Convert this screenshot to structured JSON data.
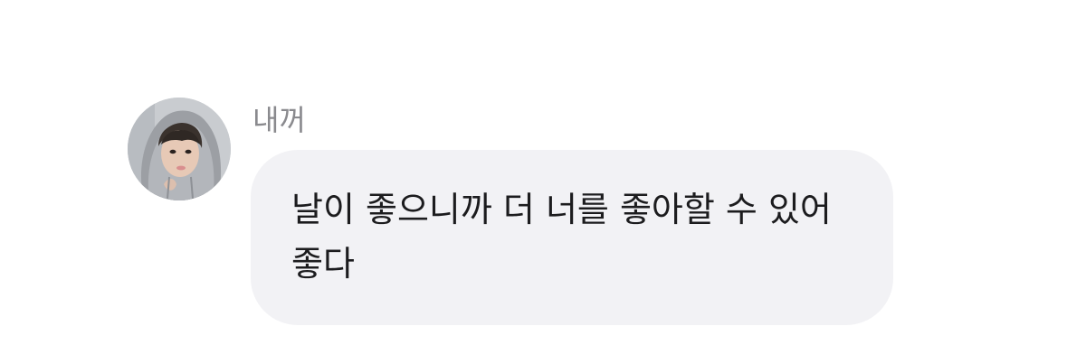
{
  "chat": {
    "message": {
      "sender_name": "내꺼",
      "text": "날이 좋으니까 더 너를 좋아할 수 있어 좋다",
      "avatar": "profile-photo-person-in-grey-hood"
    }
  },
  "colors": {
    "background": "#ffffff",
    "bubble": "#f2f2f5",
    "sender_name": "#8a8a8e",
    "message_text": "#1c1c1e"
  }
}
